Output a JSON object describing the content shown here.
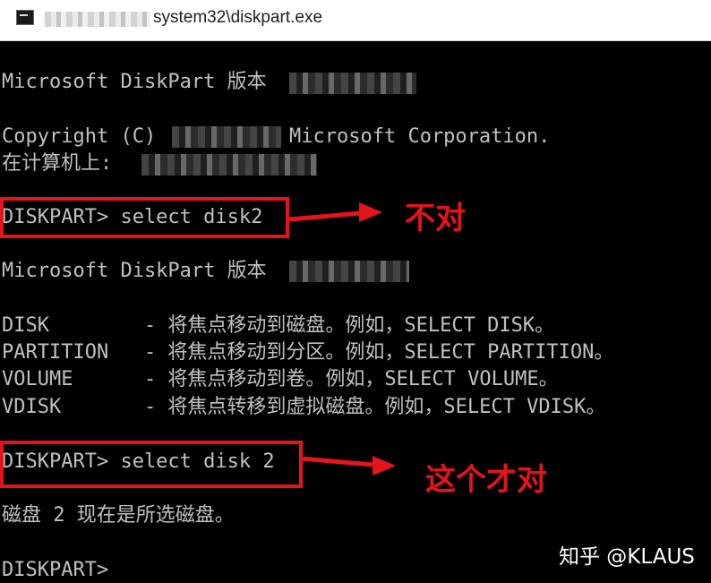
{
  "window": {
    "title": "system32\\diskpart.exe",
    "icon": "console-icon"
  },
  "console": {
    "line1": "Microsoft DiskPart 版本",
    "line2": "Copyright (C)",
    "line2b": "Microsoft Corporation.",
    "line3": "在计算机上:",
    "cmd1": "DISKPART> select disk2",
    "line4": "Microsoft DiskPart 版本",
    "help": [
      "DISK        - 将焦点移动到磁盘。例如，SELECT DISK。",
      "PARTITION   - 将焦点移动到分区。例如，SELECT PARTITION。",
      "VOLUME      - 将焦点移动到卷。例如，SELECT VOLUME。",
      "VDISK       - 将焦点转移到虚拟磁盘。例如，SELECT VDISK。"
    ],
    "cmd2": "DISKPART> select disk 2",
    "result": "磁盘 2 现在是所选磁盘。",
    "prompt": "DISKPART>"
  },
  "annotations": {
    "wrong": "不对",
    "right": "这个才对"
  },
  "watermark": "知乎 @KLAUS",
  "colors": {
    "accent": "#e5141b",
    "console_text": "#c0c0c0",
    "background": "#000000"
  }
}
